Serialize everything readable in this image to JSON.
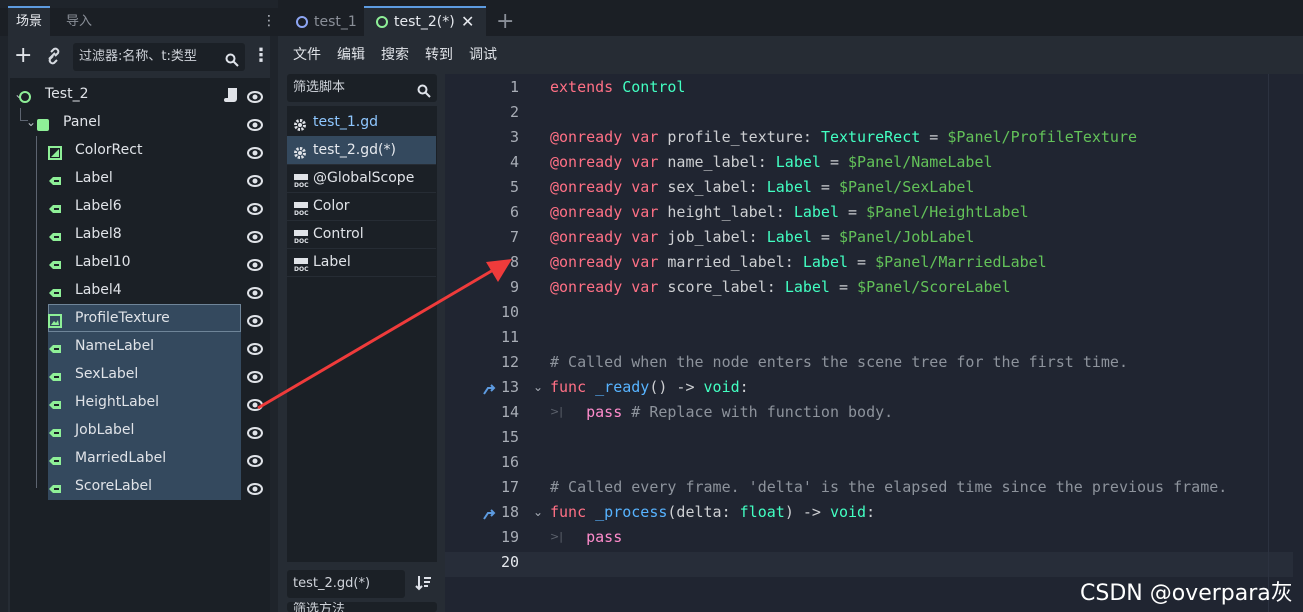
{
  "dock": {
    "tab_scene": "场景",
    "tab_import": "导入",
    "filter_placeholder": "过滤器:名称、t:类型"
  },
  "scene_tree": [
    {
      "label": "Test_2",
      "icon": "control-node-icon"
    },
    {
      "label": "Panel",
      "icon": "panel-icon"
    },
    {
      "label": "ColorRect",
      "icon": "colorrect-icon"
    },
    {
      "label": "Label",
      "icon": "label-icon"
    },
    {
      "label": "Label6",
      "icon": "label-icon"
    },
    {
      "label": "Label8",
      "icon": "label-icon"
    },
    {
      "label": "Label10",
      "icon": "label-icon"
    },
    {
      "label": "Label4",
      "icon": "label-icon"
    },
    {
      "label": "ProfileTexture",
      "icon": "texturerect-icon"
    },
    {
      "label": "NameLabel",
      "icon": "label-icon"
    },
    {
      "label": "SexLabel",
      "icon": "label-icon"
    },
    {
      "label": "HeightLabel",
      "icon": "label-icon"
    },
    {
      "label": "JobLabel",
      "icon": "label-icon"
    },
    {
      "label": "MarriedLabel",
      "icon": "label-icon"
    },
    {
      "label": "ScoreLabel",
      "icon": "label-icon"
    }
  ],
  "script_tabs": [
    {
      "label": "test_1"
    },
    {
      "label": "test_2(*)"
    }
  ],
  "menu": [
    "文件",
    "编辑",
    "搜索",
    "转到",
    "调试"
  ],
  "script_filter_placeholder": "筛选脚本",
  "scripts": [
    {
      "label": "test_1.gd",
      "icon": "gear-icon"
    },
    {
      "label": "test_2.gd(*)",
      "icon": "gear-icon"
    },
    {
      "label": "@GlobalScope",
      "icon": "doc-icon"
    },
    {
      "label": "Color",
      "icon": "doc-icon"
    },
    {
      "label": "Control",
      "icon": "doc-icon"
    },
    {
      "label": "Label",
      "icon": "doc-icon"
    }
  ],
  "current_script": "test_2.gd(*)",
  "methods_filter_placeholder": "筛选方法",
  "code_lines": [
    [
      [
        "kw",
        "extends"
      ],
      [
        "pl",
        " "
      ],
      [
        "ty",
        "Control"
      ]
    ],
    [],
    [
      [
        "kw",
        "@onready"
      ],
      [
        "pl",
        " "
      ],
      [
        "kw",
        "var"
      ],
      [
        "pl",
        " profile_texture: "
      ],
      [
        "ty",
        "TextureRect"
      ],
      [
        "pl",
        " = "
      ],
      [
        "np",
        "$Panel/ProfileTexture"
      ]
    ],
    [
      [
        "kw",
        "@onready"
      ],
      [
        "pl",
        " "
      ],
      [
        "kw",
        "var"
      ],
      [
        "pl",
        " name_label: "
      ],
      [
        "ty",
        "Label"
      ],
      [
        "pl",
        " = "
      ],
      [
        "np",
        "$Panel/NameLabel"
      ]
    ],
    [
      [
        "kw",
        "@onready"
      ],
      [
        "pl",
        " "
      ],
      [
        "kw",
        "var"
      ],
      [
        "pl",
        " sex_label: "
      ],
      [
        "ty",
        "Label"
      ],
      [
        "pl",
        " = "
      ],
      [
        "np",
        "$Panel/SexLabel"
      ]
    ],
    [
      [
        "kw",
        "@onready"
      ],
      [
        "pl",
        " "
      ],
      [
        "kw",
        "var"
      ],
      [
        "pl",
        " height_label: "
      ],
      [
        "ty",
        "Label"
      ],
      [
        "pl",
        " = "
      ],
      [
        "np",
        "$Panel/HeightLabel"
      ]
    ],
    [
      [
        "kw",
        "@onready"
      ],
      [
        "pl",
        " "
      ],
      [
        "kw",
        "var"
      ],
      [
        "pl",
        " job_label: "
      ],
      [
        "ty",
        "Label"
      ],
      [
        "pl",
        " = "
      ],
      [
        "np",
        "$Panel/JobLabel"
      ]
    ],
    [
      [
        "kw",
        "@onready"
      ],
      [
        "pl",
        " "
      ],
      [
        "kw",
        "var"
      ],
      [
        "pl",
        " married_label: "
      ],
      [
        "ty",
        "Label"
      ],
      [
        "pl",
        " = "
      ],
      [
        "np",
        "$Panel/MarriedLabel"
      ]
    ],
    [
      [
        "kw",
        "@onready"
      ],
      [
        "pl",
        " "
      ],
      [
        "kw",
        "var"
      ],
      [
        "pl",
        " score_label: "
      ],
      [
        "ty",
        "Label"
      ],
      [
        "pl",
        " = "
      ],
      [
        "np",
        "$Panel/ScoreLabel"
      ]
    ],
    [],
    [],
    [
      [
        "cm",
        "# Called when the node enters the scene tree for the first time."
      ]
    ],
    [
      [
        "kw",
        "func"
      ],
      [
        "pl",
        " "
      ],
      [
        "fn",
        "_ready"
      ],
      [
        "pl",
        "() -> "
      ],
      [
        "ty",
        "void"
      ],
      [
        "pl",
        ":"
      ]
    ],
    [
      [
        "pl",
        "    "
      ],
      [
        "kw2",
        "pass"
      ],
      [
        "cm",
        " # Replace with function body."
      ]
    ],
    [],
    [],
    [
      [
        "cm",
        "# Called every frame. 'delta' is the elapsed time since the previous frame."
      ]
    ],
    [
      [
        "kw",
        "func"
      ],
      [
        "pl",
        " "
      ],
      [
        "fn",
        "_process"
      ],
      [
        "pl",
        "(delta: "
      ],
      [
        "ty",
        "float"
      ],
      [
        "pl",
        ") -> "
      ],
      [
        "ty",
        "void"
      ],
      [
        "pl",
        ":"
      ]
    ],
    [
      [
        "pl",
        "    "
      ],
      [
        "kw2",
        "pass"
      ]
    ],
    []
  ],
  "watermark": "CSDN @overpara灰"
}
